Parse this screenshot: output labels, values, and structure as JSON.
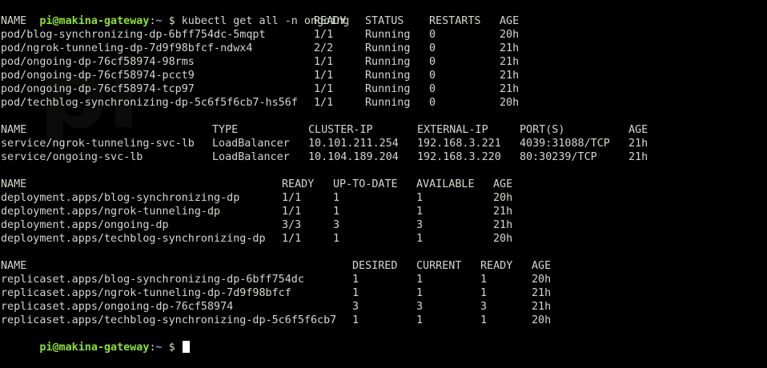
{
  "prompt": {
    "user_host": "pi@makina-gateway",
    "colon": ":",
    "path": "~",
    "symbol": " $ ",
    "command": "kubectl get all -n ongoing",
    "watermark_logo": "pi"
  },
  "pods": {
    "headers": [
      "NAME",
      "READY",
      "STATUS",
      "RESTARTS",
      "AGE"
    ],
    "rows": [
      [
        "pod/blog-synchronizing-dp-6bff754dc-5mqpt",
        "1/1",
        "Running",
        "0",
        "20h"
      ],
      [
        "pod/ngrok-tunneling-dp-7d9f98bfcf-ndwx4",
        "2/2",
        "Running",
        "0",
        "21h"
      ],
      [
        "pod/ongoing-dp-76cf58974-98rms",
        "1/1",
        "Running",
        "0",
        "21h"
      ],
      [
        "pod/ongoing-dp-76cf58974-pcct9",
        "1/1",
        "Running",
        "0",
        "21h"
      ],
      [
        "pod/ongoing-dp-76cf58974-tcp97",
        "1/1",
        "Running",
        "0",
        "21h"
      ],
      [
        "pod/techblog-synchronizing-dp-5c6f5f6cb7-hs56f",
        "1/1",
        "Running",
        "0",
        "20h"
      ]
    ]
  },
  "services": {
    "headers": [
      "NAME",
      "TYPE",
      "CLUSTER-IP",
      "EXTERNAL-IP",
      "PORT(S)",
      "AGE"
    ],
    "rows": [
      [
        "service/ngrok-tunneling-svc-lb",
        "LoadBalancer",
        "10.101.211.254",
        "192.168.3.221",
        "4039:31088/TCP",
        "21h"
      ],
      [
        "service/ongoing-svc-lb",
        "LoadBalancer",
        "10.104.189.204",
        "192.168.3.220",
        "80:30239/TCP",
        "21h"
      ]
    ]
  },
  "deployments": {
    "headers": [
      "NAME",
      "READY",
      "UP-TO-DATE",
      "AVAILABLE",
      "AGE"
    ],
    "rows": [
      [
        "deployment.apps/blog-synchronizing-dp",
        "1/1",
        "1",
        "1",
        "20h"
      ],
      [
        "deployment.apps/ngrok-tunneling-dp",
        "1/1",
        "1",
        "1",
        "21h"
      ],
      [
        "deployment.apps/ongoing-dp",
        "3/3",
        "3",
        "3",
        "21h"
      ],
      [
        "deployment.apps/techblog-synchronizing-dp",
        "1/1",
        "1",
        "1",
        "20h"
      ]
    ]
  },
  "replicasets": {
    "headers": [
      "NAME",
      "DESIRED",
      "CURRENT",
      "READY",
      "AGE"
    ],
    "rows": [
      [
        "replicaset.apps/blog-synchronizing-dp-6bff754dc",
        "1",
        "1",
        "1",
        "20h"
      ],
      [
        "replicaset.apps/ngrok-tunneling-dp-7d9f98bfcf",
        "1",
        "1",
        "1",
        "21h"
      ],
      [
        "replicaset.apps/ongoing-dp-76cf58974",
        "3",
        "3",
        "3",
        "21h"
      ],
      [
        "replicaset.apps/techblog-synchronizing-dp-5c6f5f6cb7",
        "1",
        "1",
        "1",
        "20h"
      ]
    ]
  },
  "colors": {
    "background": "#000000",
    "text": "#d3d7cf",
    "prompt_user": "#8ae234",
    "prompt_path": "#729fcf"
  }
}
